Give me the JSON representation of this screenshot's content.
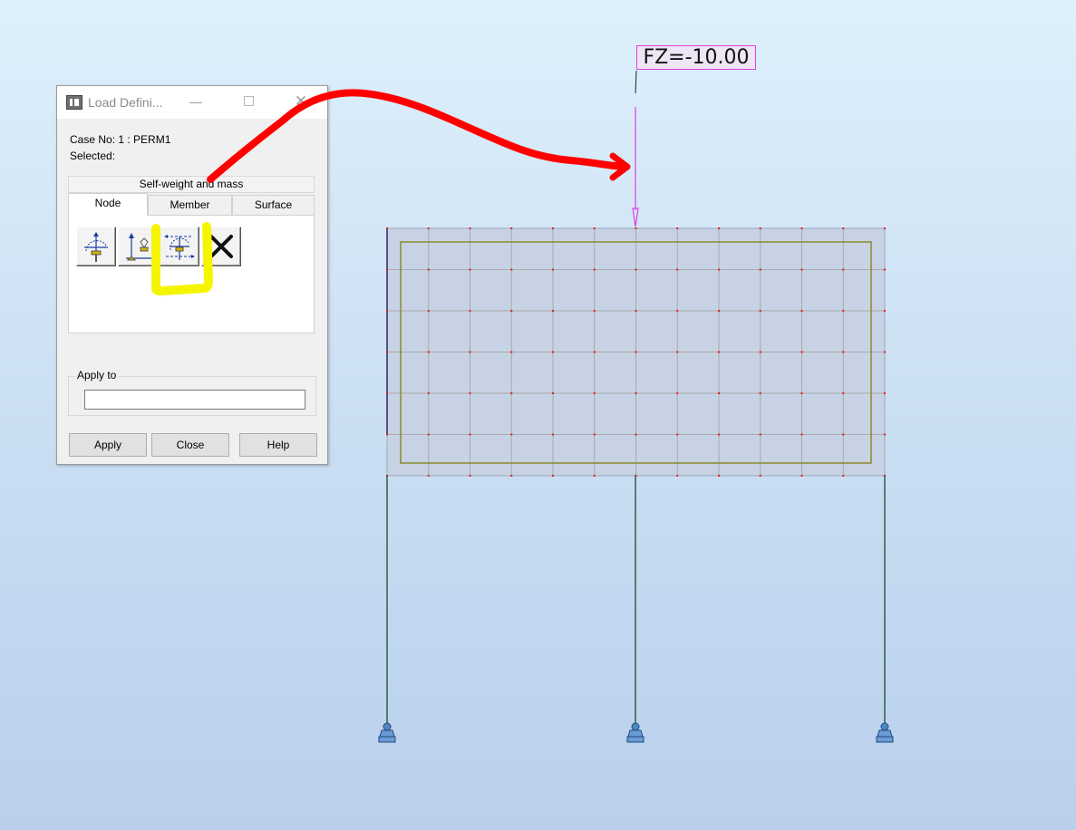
{
  "viewport": {
    "load_label": "FZ=-10.00",
    "colors": {
      "background_top": "#def0fb",
      "background_bottom": "#b9cfec",
      "slab_fill": "#c7d3e5",
      "grid_line": "#a9a9a9",
      "node_dot": "#e02020",
      "panel_outline": "#8a8a2a",
      "column": "#2e5e4a",
      "load_arrow": "#e040e0",
      "support": "#4f86c6"
    },
    "supports_count": 3
  },
  "dialog": {
    "title": "Load Defini...",
    "window_controls": {
      "minimize": "—",
      "close": "✕"
    },
    "case_no": "Case No: 1 : PERM1",
    "selected": "Selected:",
    "self_weight_header": "Self-weight and mass",
    "tabs": [
      {
        "label": "Node",
        "active": true
      },
      {
        "label": "Member",
        "active": false
      },
      {
        "label": "Surface",
        "active": false
      }
    ],
    "tools": [
      {
        "icon": "nodal-force-icon"
      },
      {
        "icon": "support-displacement-icon"
      },
      {
        "icon": "in-contour-force-icon",
        "highlighted": true
      },
      {
        "icon": "delete-load-icon"
      }
    ],
    "apply_to_label": "Apply to",
    "apply_to_value": "",
    "buttons": {
      "apply": "Apply",
      "close": "Close",
      "help": "Help"
    }
  },
  "annotations": {
    "highlight_color": "#f5f500",
    "arrow_color": "#ff0000"
  }
}
